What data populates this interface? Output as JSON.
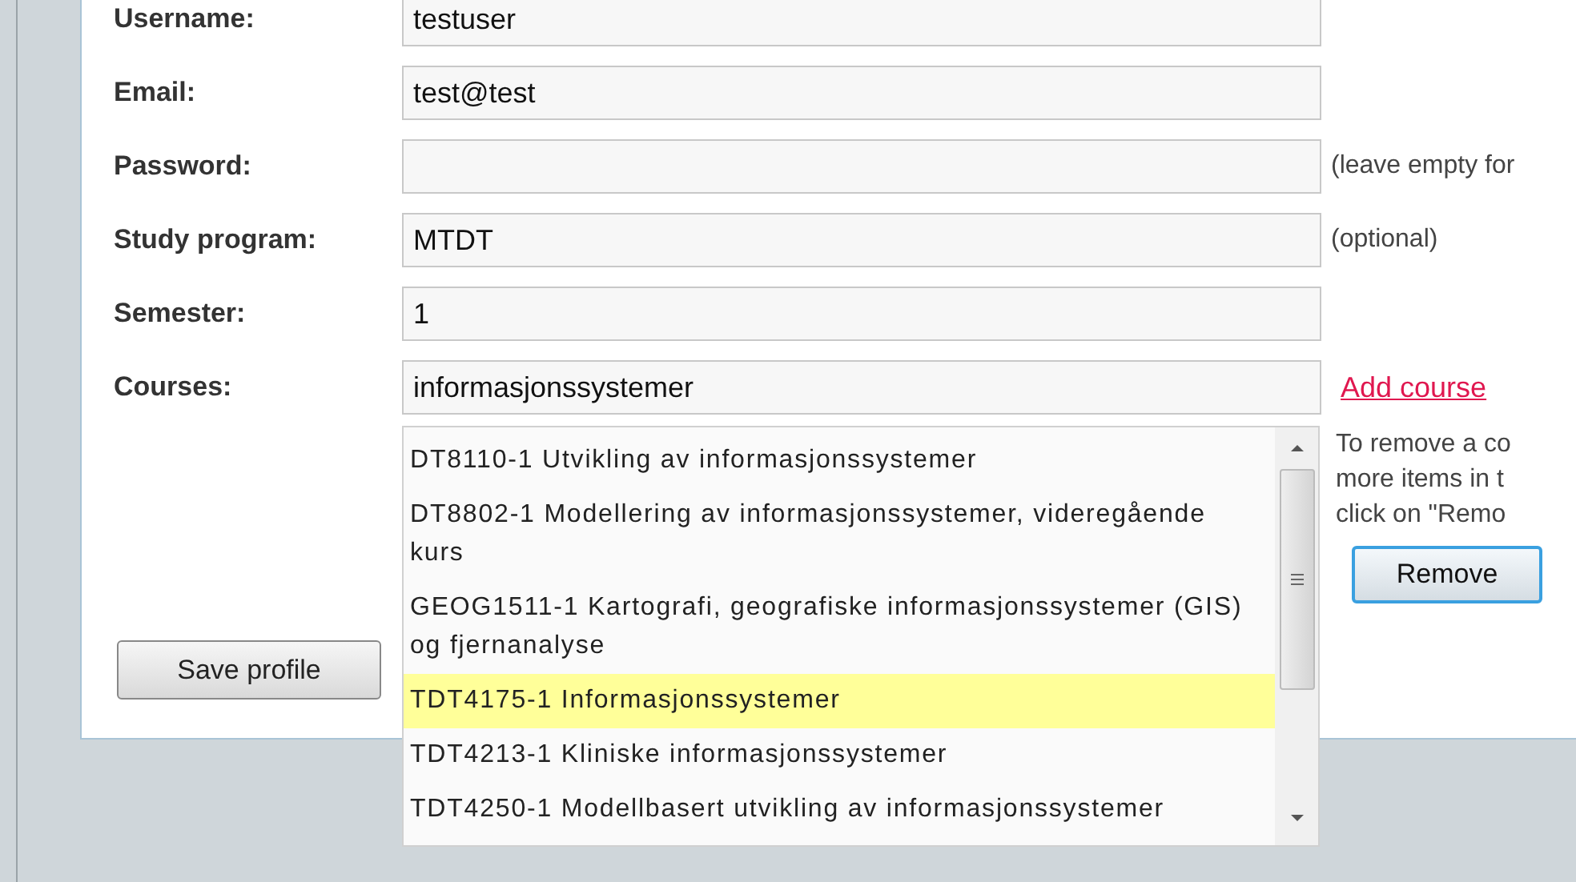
{
  "fields": [
    {
      "label": "Username:",
      "value": "testuser"
    },
    {
      "label": "Email:",
      "value": "test@test"
    },
    {
      "label": "Password:",
      "note": "(leave empty for"
    },
    {
      "label": "Study program:",
      "value": "MTDT",
      "note": "(optional)"
    },
    {
      "label": "Semester:",
      "value": "1"
    }
  ],
  "courses": {
    "label": "Courses:",
    "value": "informasjonssystemer",
    "add_link": "Add course",
    "suggestions": [
      {
        "text": "DT8110-1 Utvikling av informasjonssystemer",
        "selected": false
      },
      {
        "text": "DT8802-1 Modellering av informasjonssystemer, videregående kurs",
        "selected": false
      },
      {
        "text": "GEOG1511-1 Kartografi, geografiske informasjonssystemer (GIS) og fjernanalyse",
        "selected": false
      },
      {
        "text": "TDT4175-1 Informasjonssystemer",
        "selected": true
      },
      {
        "text": "TDT4213-1 Kliniske informasjonssystemer",
        "selected": false
      },
      {
        "text": "TDT4250-1 Modellbasert utvikling av informasjonssystemer",
        "selected": false
      }
    ],
    "help_lines": [
      "To remove a co",
      "more items in t",
      "click on \"Remo"
    ],
    "remove_button": "Remove"
  },
  "save_button": "Save profile"
}
